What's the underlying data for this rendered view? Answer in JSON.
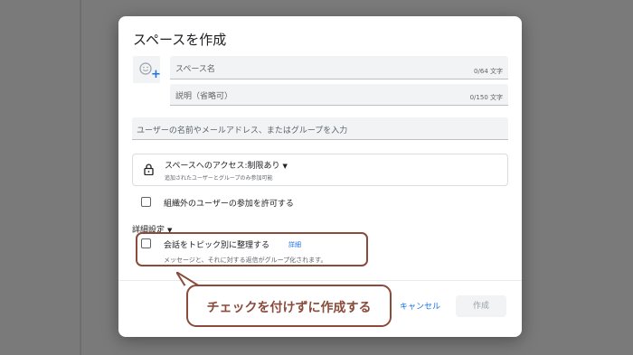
{
  "dialog": {
    "title": "スペースを作成",
    "name_field": {
      "placeholder": "スペース名",
      "counter": "0/64 文字"
    },
    "description_field": {
      "placeholder": "説明（省略可）",
      "counter": "0/150 文字"
    },
    "users_field": {
      "placeholder": "ユーザーの名前やメールアドレス、またはグループを入力"
    },
    "access": {
      "title": "スペースへのアクセス:制限あり",
      "subtitle": "追加されたユーザーとグループのみ参加可能"
    },
    "external_users": {
      "label": "組織外のユーザーの参加を許可する",
      "checked": false
    },
    "advanced_label": "詳細設定",
    "topic_option": {
      "label": "会話をトピック別に整理する",
      "link": "詳細",
      "description": "メッセージと、それに対する返信がグループ化されます。",
      "checked": false
    },
    "buttons": {
      "cancel": "キャンセル",
      "create": "作成"
    }
  },
  "annotation": {
    "callout_text": "チェックを付けずに作成する",
    "color": "#8a4b3a"
  },
  "colors": {
    "accent": "#1a73e8",
    "field_bg": "#f1f3f4",
    "overlay": "#7a7a7a"
  },
  "icons": [
    "emoji-add-icon",
    "lock-icon",
    "caret-down-icon"
  ]
}
